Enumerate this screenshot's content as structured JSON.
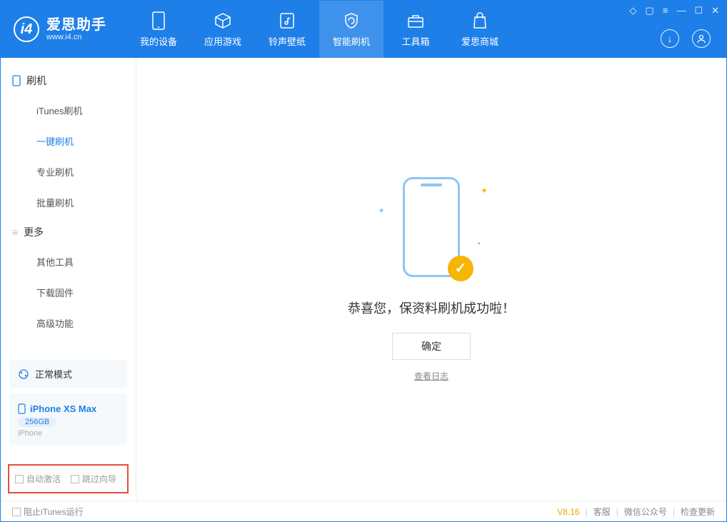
{
  "app": {
    "title": "爱思助手",
    "subtitle": "www.i4.cn"
  },
  "nav": {
    "items": [
      {
        "label": "我的设备"
      },
      {
        "label": "应用游戏"
      },
      {
        "label": "铃声壁纸"
      },
      {
        "label": "智能刷机"
      },
      {
        "label": "工具箱"
      },
      {
        "label": "爱思商城"
      }
    ]
  },
  "sidebar": {
    "section1": "刷机",
    "items1": [
      "iTunes刷机",
      "一键刷机",
      "专业刷机",
      "批量刷机"
    ],
    "section2": "更多",
    "items2": [
      "其他工具",
      "下载固件",
      "高级功能"
    ]
  },
  "device": {
    "mode": "正常模式",
    "name": "iPhone XS Max",
    "capacity": "256GB",
    "type": "iPhone"
  },
  "checks": {
    "auto_activate": "自动激活",
    "skip_guide": "跳过向导"
  },
  "main": {
    "success": "恭喜您，保资料刷机成功啦！",
    "ok": "确定",
    "view_log": "查看日志"
  },
  "footer": {
    "block_itunes": "阻止iTunes运行",
    "version": "V8.16",
    "links": [
      "客服",
      "微信公众号",
      "检查更新"
    ]
  }
}
